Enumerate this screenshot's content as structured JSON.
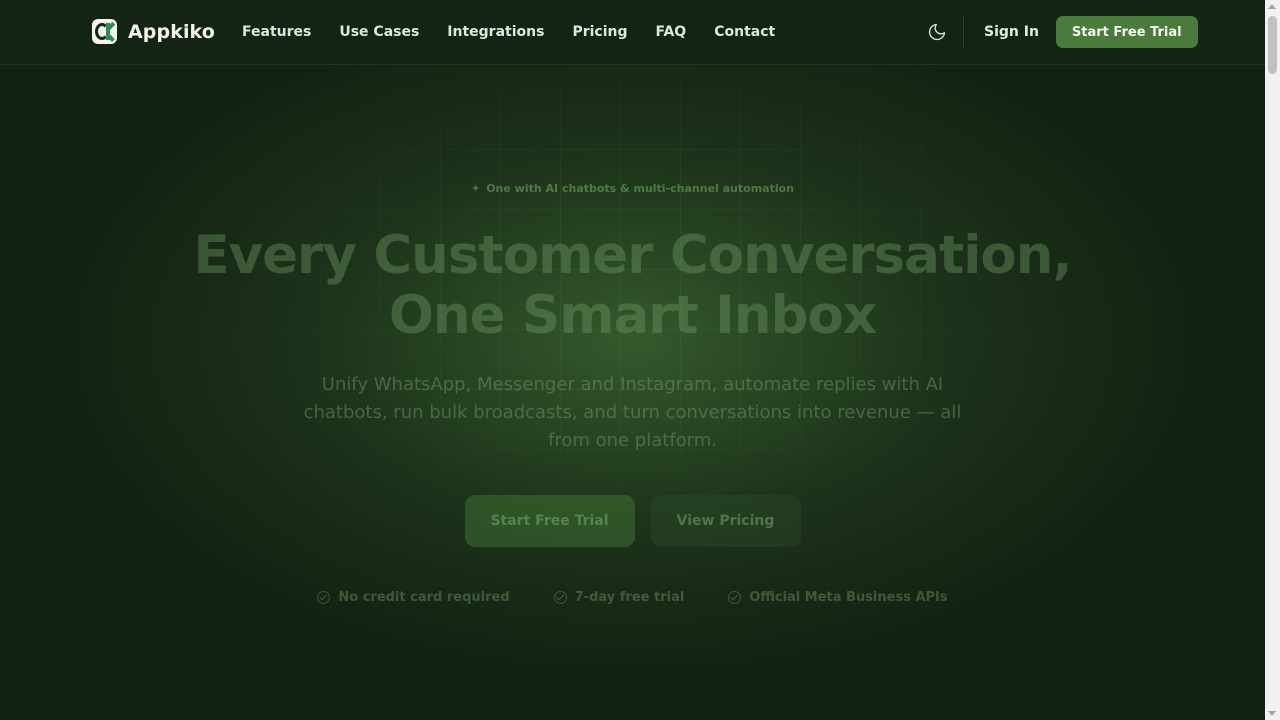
{
  "brand": {
    "name": "Appkiko"
  },
  "nav": {
    "links": [
      "Features",
      "Use Cases",
      "Integrations",
      "Pricing",
      "FAQ",
      "Contact"
    ],
    "theme_toggle_icon": "moon-icon",
    "sign_in": "Sign In",
    "cta": "Start Free Trial"
  },
  "hero": {
    "badge": "One with AI chatbots & multi-channel automation",
    "headline_line1": "Every Customer Conversation,",
    "headline_line2": "One Smart Inbox",
    "subtext": "Unify WhatsApp, Messenger and Instagram, automate replies with AI chatbots, run bulk broadcasts, and turn conversations into revenue — all from one platform.",
    "primary_button": "Start Free Trial",
    "secondary_button": "View Pricing",
    "features": [
      "No credit card required",
      "7-day free trial",
      "Official Meta Business APIs"
    ]
  },
  "colors": {
    "background": "#142213",
    "accent": "#4a7a3c",
    "text": "#e8efe6"
  }
}
